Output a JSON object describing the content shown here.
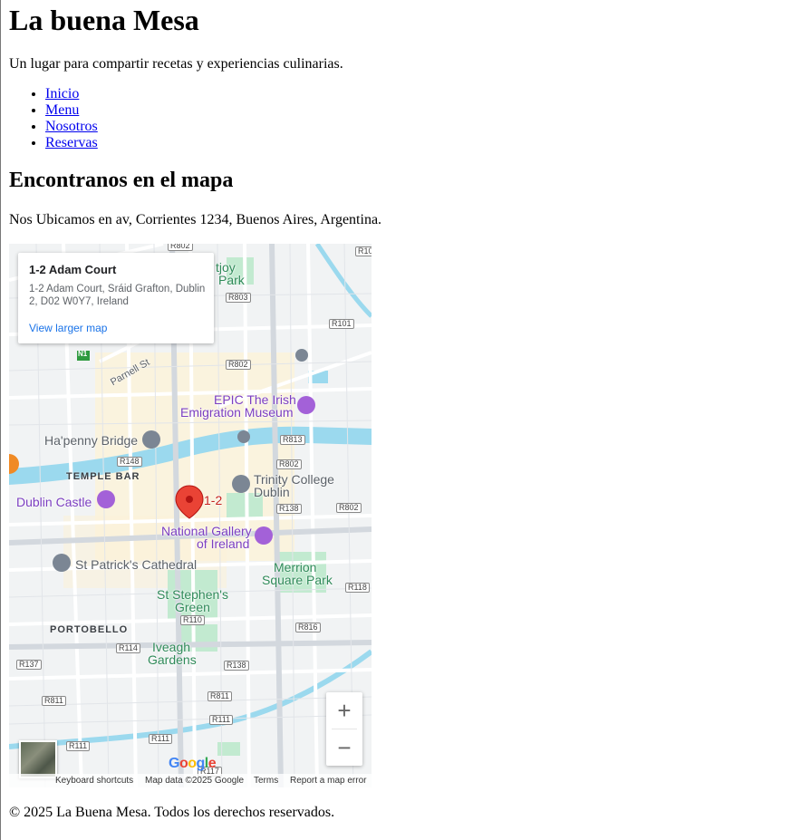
{
  "header": {
    "title": "La buena Mesa",
    "tagline": "Un lugar para compartir recetas y experiencias culinarias."
  },
  "nav": {
    "items": [
      {
        "label": "Inicio"
      },
      {
        "label": "Menu"
      },
      {
        "label": "Nosotros"
      },
      {
        "label": "Reservas"
      }
    ]
  },
  "map_section": {
    "heading": "Encontranos en el mapa",
    "address_text": "Nos Ubicamos en av, Corrientes 1234, Buenos Aires, Argentina."
  },
  "map": {
    "info_card": {
      "title": "1-2 Adam Court",
      "address": "1-2 Adam Court, Sráid Grafton, Dublin 2, D02 W0Y7, Ireland",
      "link": "View larger map"
    },
    "pin_label": "1-2",
    "places": {
      "epic": "EPIC The Irish",
      "epic2": "Emigration Museum",
      "hapenny": "Ha'penny Bridge",
      "temple_bar": "TEMPLE BAR",
      "dublin_castle": "Dublin Castle",
      "trinity": "Trinity College",
      "trinity2": "Dublin",
      "gallery": "National Gallery",
      "gallery2": "of Ireland",
      "patricks": "St Patrick's Cathedral",
      "merrion": "Merrion",
      "merrion2": "Square Park",
      "stephens": "St Stephen's",
      "stephens2": "Green",
      "portobello": "PORTOBELLO",
      "iveagh": "Iveagh",
      "iveagh2": "Gardens",
      "parnell": "Parnell St",
      "joy": "tjoy",
      "joy2": "Park",
      "n1": "N1"
    },
    "roads": {
      "r802a": "R802",
      "r10": "R10",
      "r803": "R803",
      "r101": "R101",
      "r802b": "R802",
      "r813": "R813",
      "r148": "R148",
      "r802c": "R802",
      "r138a": "R138",
      "r802d": "R802",
      "r118": "R118",
      "r110": "R110",
      "r816": "R816",
      "r114": "R114",
      "r137": "R137",
      "r138b": "R138",
      "r811a": "R811",
      "r811b": "R811",
      "r111a": "R111",
      "r111b": "R111",
      "r111c": "R111",
      "r117": "R117"
    },
    "zoom_in": "+",
    "zoom_out": "−",
    "google_logo": "Google",
    "footer_links": {
      "shortcuts": "Keyboard shortcuts",
      "data": "Map data ©2025 Google",
      "terms": "Terms",
      "report": "Report a map error"
    },
    "colors": {
      "water": "#9bd9ee",
      "park": "#c2ead0",
      "pin": "#ea4335",
      "link": "#1a73e8"
    }
  },
  "footer": {
    "text": "© 2025 La Buena Mesa. Todos los derechos reservados."
  }
}
